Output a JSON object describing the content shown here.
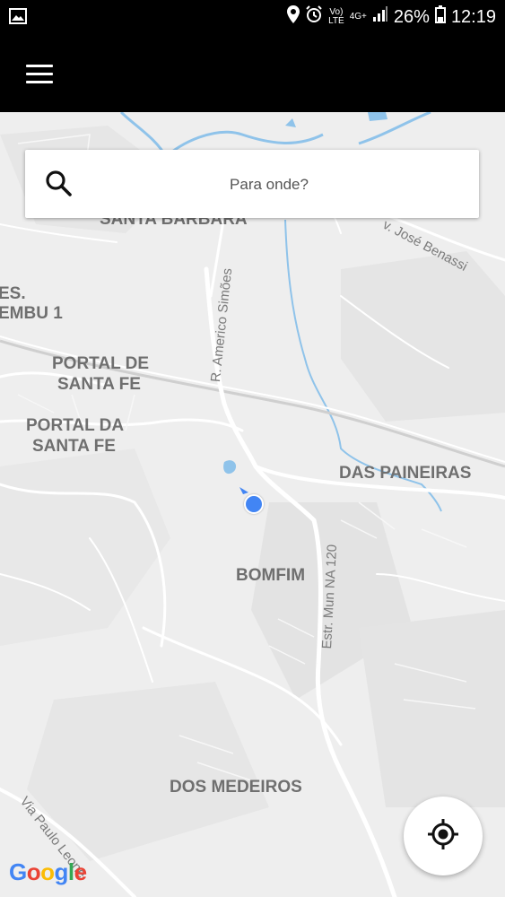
{
  "status_bar": {
    "volte_top": "Vo)",
    "volte_bottom": "LTE",
    "network": "4G+",
    "battery": "26%",
    "time": "12:19",
    "icons": [
      "gallery-notification-icon",
      "location-icon",
      "alarm-icon",
      "volte-icon",
      "signal-icon",
      "battery-icon"
    ]
  },
  "app_bar": {
    "menu_icon": "hamburger-menu-icon"
  },
  "search": {
    "placeholder": "Para onde?",
    "icon": "search-icon"
  },
  "map": {
    "neighborhoods": {
      "santa_barbara": "SANTA BARBARA",
      "es_top": "ES.",
      "es_bottom": "EMBU 1",
      "portal_de_line1": "PORTAL DE",
      "portal_de_line2": "SANTA FE",
      "portal_da_line1": "PORTAL DA",
      "portal_da_line2": "SANTA FE",
      "das_paineiras": "DAS PAINEIRAS",
      "bomfim": "BOMFIM",
      "dos_medeiros": "DOS MEDEIROS"
    },
    "streets": {
      "jose_benassi": "v. José Benassi",
      "americo_simoes": "R. Americo Simões",
      "estr_mun": "Estr. Mun NA 120",
      "via_paulo_leone": "Via Paulo Leone"
    },
    "colors": {
      "background": "#eeeeee",
      "road": "#ffffff",
      "water": "#8fc3ea",
      "location": "#4285f4"
    }
  },
  "locate_button": {
    "icon": "my-location-icon"
  },
  "attribution": {
    "letters": [
      "G",
      "o",
      "o",
      "g",
      "l",
      "e"
    ],
    "colors": [
      "#4285f4",
      "#ea4335",
      "#fbbc05",
      "#4285f4",
      "#34a853",
      "#ea4335"
    ]
  }
}
